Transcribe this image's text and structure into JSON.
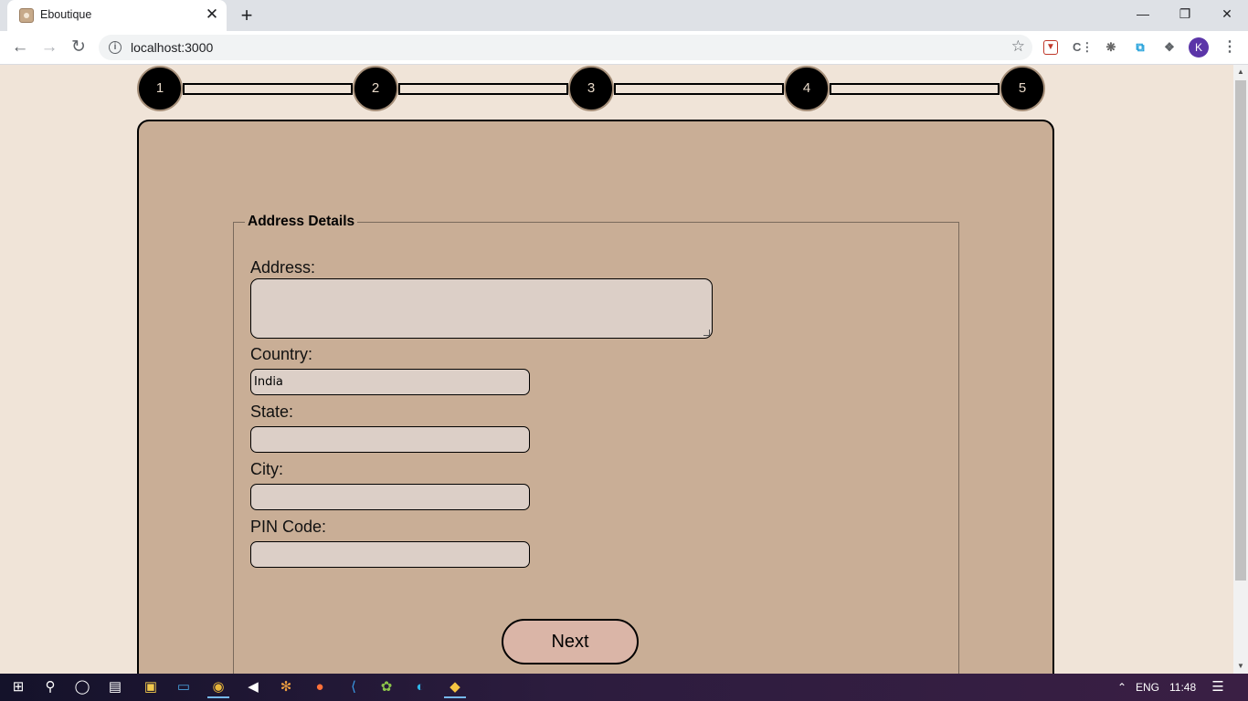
{
  "browser": {
    "tab_title": "Eboutique",
    "url": "localhost:3000",
    "avatar_letter": "K",
    "new_tab_label": "+",
    "close_label": "✕"
  },
  "stepper": {
    "steps": [
      "1",
      "2",
      "3",
      "4",
      "5"
    ]
  },
  "form": {
    "legend": "Address Details",
    "address_label": "Address:",
    "address_value": "",
    "country_label": "Country:",
    "country_value": "India",
    "state_label": "State:",
    "state_value": "",
    "city_label": "City:",
    "city_value": "",
    "pin_label": "PIN Code:",
    "pin_value": "",
    "next_label": "Next"
  },
  "taskbar": {
    "language": "ENG",
    "time": "11:48"
  },
  "colors": {
    "page_background": "#f0e4d8",
    "card_background": "#c9ae96",
    "input_background": "#dccfc7",
    "button_background": "#dab5a7",
    "step_circle": "#000000"
  }
}
